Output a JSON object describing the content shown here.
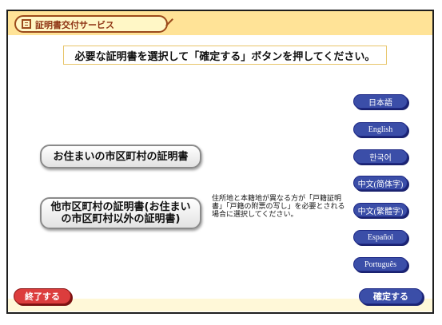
{
  "header": {
    "title": "証明書交付サービス"
  },
  "instruction": "必要な証明書を選択して「確定する」ボタンを押してください。",
  "certificates": {
    "home": "お住まいの市区町村の証明書",
    "other": "他市区町村の証明書(お住まいの市区町村以外の証明書)"
  },
  "note": "住所地と本籍地が異なる方が「戸籍証明書」「戸籍の附票の写し」を必要とされる場合に選択してください。",
  "languages": [
    "日本語",
    "English",
    "한국어",
    "中文(简体字)",
    "中文(繁體字)",
    "Español",
    "Português"
  ],
  "footer": {
    "end_label": "終了する",
    "confirm_label": "確定する"
  },
  "colors": {
    "header_background": "#ffe397",
    "language_button": "#3b4ea8",
    "end_button": "#dc3d3d",
    "confirm_button": "#3b4ea8"
  }
}
